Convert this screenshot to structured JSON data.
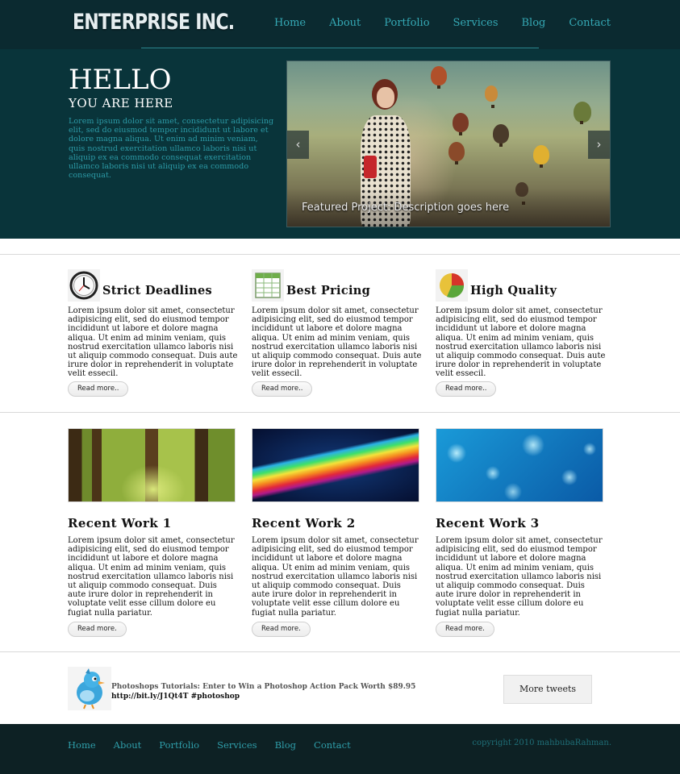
{
  "header": {
    "logo": "ENTERPRISE INC.",
    "nav": [
      "Home",
      "About",
      "Portfolio",
      "Services",
      "Blog",
      "Contact"
    ]
  },
  "hero": {
    "title": "HELLO",
    "subtitle": "YOU ARE HERE",
    "text": "Lorem ipsum dolor sit amet, consectetur adipisicing elit, sed do eiusmod tempor incididunt ut labore et dolore magna aliqua. Ut enim ad minim veniam, quis nostrud exercitation ullamco laboris nisi ut aliquip ex ea commodo consequat exercitation ullamco laboris nisi ut aliquip ex ea commodo consequat.",
    "slider_caption": "Featured Project: Description goes here",
    "prev_glyph": "‹",
    "next_glyph": "›"
  },
  "features": [
    {
      "title": "Strict Deadlines",
      "icon": "clock-icon",
      "text": "Lorem ipsum dolor sit amet, consectetur adipisicing elit, sed do eiusmod tempor incididunt ut labore et dolore magna aliqua. Ut enim ad minim veniam, quis nostrud exercitation ullamco laboris nisi ut aliquip commodo consequat. Duis aute irure dolor in reprehenderit in voluptate velit essecil.",
      "button": "Read more.."
    },
    {
      "title": "Best Pricing",
      "icon": "spreadsheet-icon",
      "text": "Lorem ipsum dolor sit amet, consectetur adipisicing elit, sed do eiusmod tempor incididunt ut labore et dolore magna aliqua. Ut enim ad minim veniam, quis nostrud exercitation ullamco laboris nisi ut aliquip commodo consequat. Duis aute irure dolor in reprehenderit in voluptate velit essecil.",
      "button": "Read more.."
    },
    {
      "title": "High Quality",
      "icon": "pie-chart-icon",
      "text": "Lorem ipsum dolor sit amet, consectetur adipisicing elit, sed do eiusmod tempor incididunt ut labore et dolore magna aliqua. Ut enim ad minim veniam, quis nostrud exercitation ullamco laboris nisi ut aliquip commodo consequat. Duis aute irure dolor in reprehenderit in voluptate velit essecil.",
      "button": "Read more.."
    }
  ],
  "works": [
    {
      "title": "Recent Work 1",
      "image": "forest-path-image",
      "text": "Lorem ipsum dolor sit amet, consectetur adipisicing elit, sed do eiusmod tempor incididunt ut labore et dolore magna aliqua. Ut enim ad minim veniam, quis nostrud exercitation ullamco laboris nisi ut aliquip commodo consequat. Duis aute irure dolor in reprehenderit in voluptate velit esse cillum dolore eu fugiat nulla pariatur.",
      "button": "Read more."
    },
    {
      "title": "Recent Work 2",
      "image": "rainbow-wave-image",
      "text": "Lorem ipsum dolor sit amet, consectetur adipisicing elit, sed do eiusmod tempor incididunt ut labore et dolore magna aliqua. Ut enim ad minim veniam, quis nostrud exercitation ullamco laboris nisi ut aliquip commodo consequat. Duis aute irure dolor in reprehenderit in voluptate velit esse cillum dolore eu fugiat nulla pariatur.",
      "button": "Read more."
    },
    {
      "title": "Recent Work 3",
      "image": "blue-bokeh-image",
      "text": "Lorem ipsum dolor sit amet, consectetur adipisicing elit, sed do eiusmod tempor incididunt ut labore et dolore magna aliqua. Ut enim ad minim veniam, quis nostrud exercitation ullamco laboris nisi ut aliquip commodo consequat. Duis aute irure dolor in reprehenderit in voluptate velit esse cillum dolore eu fugiat nulla pariatur.",
      "button": "Read more."
    }
  ],
  "tweet": {
    "text": "Photoshops Tutorials: Enter to Win a Photoshop Action Pack Worth $89.95",
    "link": "http://bit.ly/J1Qt4T #photoshop",
    "button": "More tweets",
    "icon": "twitter-bird-icon"
  },
  "footer": {
    "nav": [
      "Home",
      "About",
      "Portfolio",
      "Services",
      "Blog",
      "Contact"
    ],
    "copyright": "copyright 2010 mahbubaRahman."
  },
  "colors": {
    "header_bg": "#0b2a30",
    "hero_bg": "#09343a",
    "accent": "#35a9b5",
    "footer_bg": "#0d2124"
  }
}
